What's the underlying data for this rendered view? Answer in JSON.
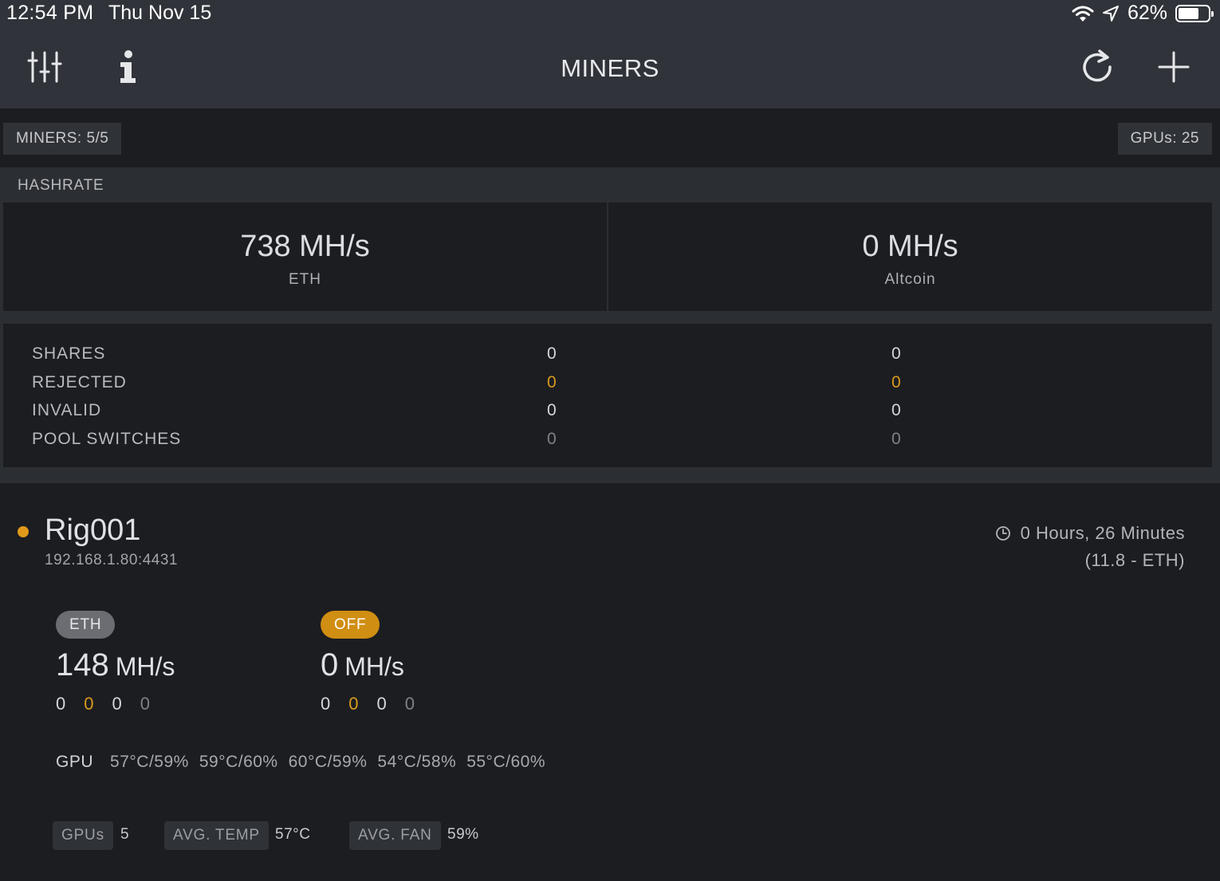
{
  "status_bar": {
    "time": "12:54 PM",
    "date": "Thu Nov 15",
    "battery": "62%"
  },
  "nav": {
    "title": "MINERS"
  },
  "summary": {
    "miners": "MINERS: 5/5",
    "gpus": "GPUs: 25"
  },
  "hashrate": {
    "header": "HASHRATE",
    "primary": {
      "value": "738 MH/s",
      "label": "ETH"
    },
    "secondary": {
      "value": "0 MH/s",
      "label": "Altcoin"
    }
  },
  "stats": [
    {
      "label": "SHARES",
      "eth": "0",
      "alt": "0"
    },
    {
      "label": "REJECTED",
      "eth": "0",
      "alt": "0"
    },
    {
      "label": "INVALID",
      "eth": "0",
      "alt": "0"
    },
    {
      "label": "POOL SWITCHES",
      "eth": "0",
      "alt": "0"
    }
  ],
  "rig": {
    "name": "Rig001",
    "address": "192.168.1.80:4431",
    "uptime": "0 Hours, 26 Minutes",
    "uptime_detail": "(11.8 - ETH)",
    "primary": {
      "badge": "ETH",
      "rate": "148",
      "unit": "MH/s",
      "counts": [
        "0",
        "0",
        "0",
        "0"
      ]
    },
    "secondary": {
      "badge": "OFF",
      "rate": "0",
      "unit": "MH/s",
      "counts": [
        "0",
        "0",
        "0",
        "0"
      ]
    },
    "gpu_label": "GPU",
    "gpus": [
      "57°C/59%",
      "59°C/60%",
      "60°C/59%",
      "54°C/58%",
      "55°C/60%"
    ],
    "footer": {
      "gpus_label": "GPUs",
      "gpus_value": "5",
      "temp_label": "AVG. TEMP",
      "temp_value": "57°C",
      "fan_label": "AVG. FAN",
      "fan_value": "59%"
    }
  },
  "colors": {
    "accent": "#d89a1c",
    "status_online": "#e09a1a",
    "background": "#1c1d21",
    "toolbar": "#30343a"
  }
}
